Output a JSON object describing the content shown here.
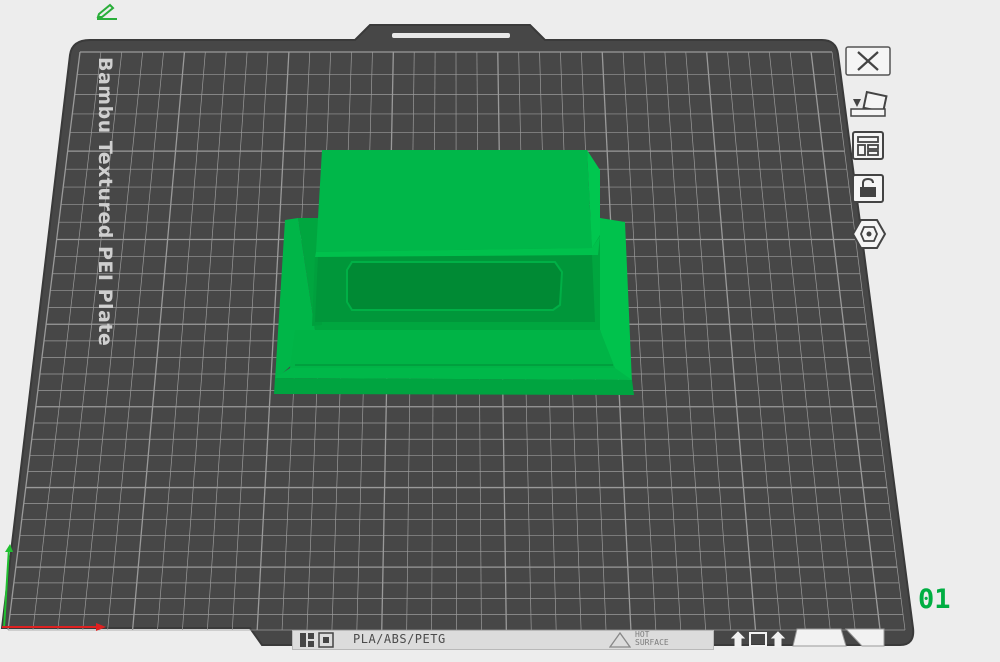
{
  "plate": {
    "label": "Bambu Textured PEI Plate",
    "number": "01",
    "material_text": "PLA/ABS/PETG",
    "hot_surface_lines": [
      "HOT",
      "SURFACE"
    ]
  },
  "toolbar": {
    "items": [
      {
        "name": "delete-plate-button",
        "icon": "close-icon"
      },
      {
        "name": "auto-orient-button",
        "icon": "auto-orient-icon"
      },
      {
        "name": "arrange-button",
        "icon": "arrange-icon"
      },
      {
        "name": "lock-plate-button",
        "icon": "lock-icon"
      },
      {
        "name": "plate-settings-button",
        "icon": "settings-hex-icon"
      }
    ]
  },
  "colors": {
    "plate": "#474747",
    "grid_line": "#9a9a9a",
    "model": "#00ae42",
    "model_dark": "#008a34",
    "accent": "#00ae42",
    "axis_x": "#e02020",
    "axis_y": "#20c030"
  }
}
